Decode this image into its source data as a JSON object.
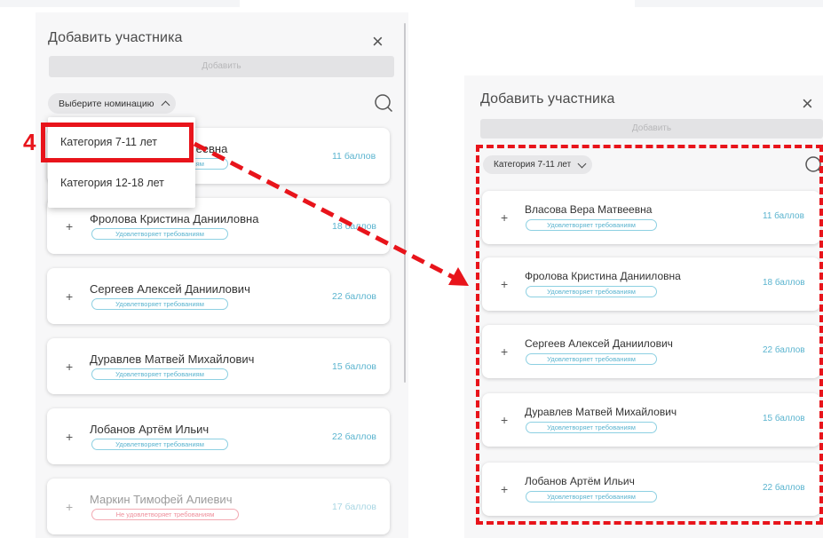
{
  "left_panel": {
    "title": "Добавить участника",
    "add_label": "Добавить",
    "select_label": "Выберите номинацию",
    "dropdown_options": [
      "Категория 7-11 лет",
      "Категория 12-18 лет"
    ],
    "participants": [
      {
        "name": "Власова Вера Матвеевна",
        "status": "Удовлетворяет требованиям",
        "score": "11 баллов",
        "eligible": true
      },
      {
        "name": "Фролова Кристина Данииловна",
        "status": "Удовлетворяет требованиям",
        "score": "18 баллов",
        "eligible": true
      },
      {
        "name": "Сергеев Алексей Даниилович",
        "status": "Удовлетворяет требованиям",
        "score": "22 баллов",
        "eligible": true
      },
      {
        "name": "Дуравлев Матвей Михайлович",
        "status": "Удовлетворяет требованиям",
        "score": "15 баллов",
        "eligible": true
      },
      {
        "name": "Лобанов Артём Ильич",
        "status": "Удовлетворяет требованиям",
        "score": "22 баллов",
        "eligible": true
      },
      {
        "name": "Маркин Тимофей Алиевич",
        "status": "Не удовлетворяет требованиям",
        "score": "17 баллов",
        "eligible": false
      }
    ]
  },
  "right_panel": {
    "title": "Добавить участника",
    "add_label": "Добавить",
    "select_label": "Категория 7-11 лет",
    "participants": [
      {
        "name": "Власова Вера Матвеевна",
        "status": "Удовлетворяет требованиям",
        "score": "11 баллов"
      },
      {
        "name": "Фролова Кристина Данииловна",
        "status": "Удовлетворяет требованиям",
        "score": "18 баллов"
      },
      {
        "name": "Сергеев Алексей Даниилович",
        "status": "Удовлетворяет требованиям",
        "score": "22 баллов"
      },
      {
        "name": "Дуравлев Матвей Михайлович",
        "status": "Удовлетворяет требованиям",
        "score": "15 баллов"
      },
      {
        "name": "Лобанов Артём Ильич",
        "status": "Удовлетворяет требованиям",
        "score": "22 баллов"
      }
    ]
  },
  "annotation": {
    "step_number": "4",
    "color": "#e8141b"
  },
  "icons": {
    "close": "close-icon",
    "search": "search-icon",
    "add": "plus-icon",
    "select_open": "chevron-up-icon",
    "select_closed": "chevron-down-icon"
  },
  "colors": {
    "accent": "#5bb4cf",
    "badge_border": "#8dd0e2",
    "negative": "#ee8f9b",
    "panel_bg": "#f7f7f8",
    "button_disabled": "#e3e3e5"
  }
}
